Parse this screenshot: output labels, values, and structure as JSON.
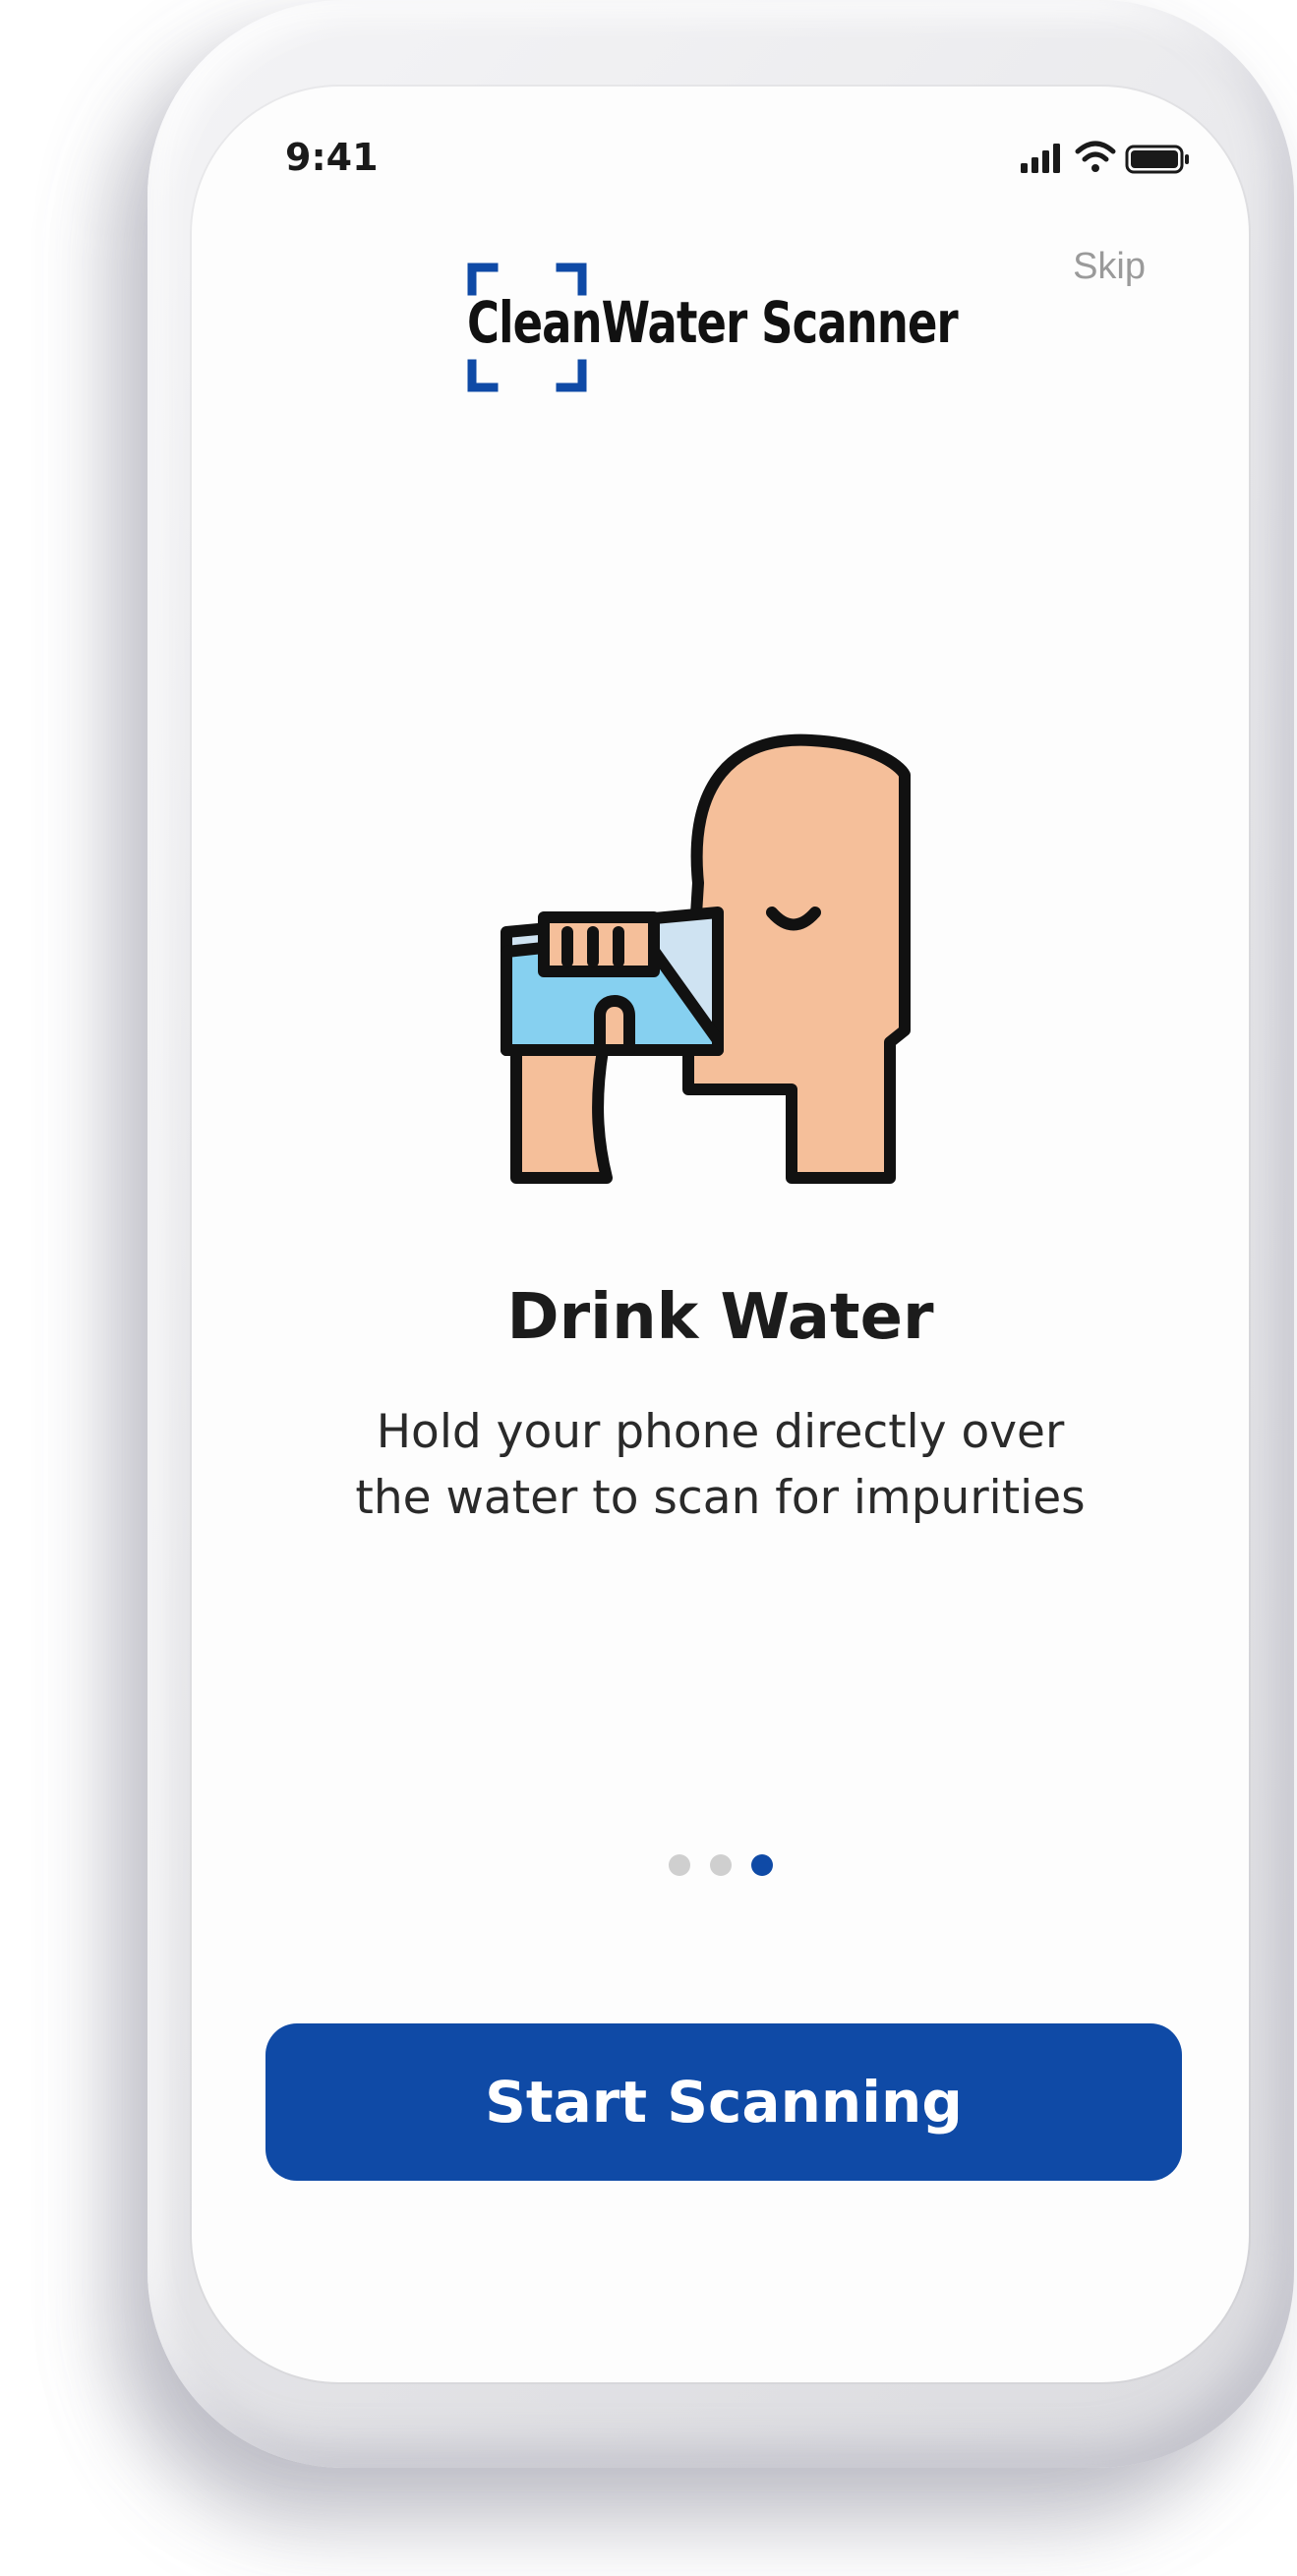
{
  "status_bar": {
    "time": "9:41",
    "icons": [
      "signal-icon",
      "wifi-icon",
      "battery-icon"
    ]
  },
  "header": {
    "logo_text": "CleanWater Scanner",
    "skip_label": "Skip"
  },
  "illustration": {
    "icon": "person-drinking-water-icon"
  },
  "content": {
    "title": "Drink Water",
    "subtitle_line1": "Hold your phone directly over",
    "subtitle_line2": "the water to scan for impurities"
  },
  "pagination": {
    "total": 3,
    "active_index": 2
  },
  "cta": {
    "label": "Start Scanning"
  },
  "colors": {
    "brand_blue": "#0f4aa6",
    "skin": "#f5bf9a",
    "water": "#86d0f0",
    "glass": "#cfe3f2",
    "outline": "#111111"
  }
}
